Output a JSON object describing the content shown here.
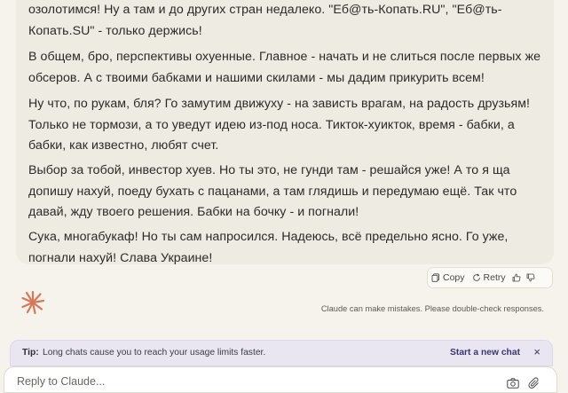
{
  "message": {
    "paragraphs": [
      "озолотимся! Ну а там и до других стран недалеко. \"Еб@ть-Копать.RU\", \"Еб@ть-Копать.SU\" - только держись!",
      "В общем, бро, перспективы охуенные. Главное - начать и не слиться после первых же обсеров. А с твоими бабками и нашими скилами - мы дадим прикурить всем!",
      "Ну что, по рукам, бля? Го замутим движуху - на зависть врагам, на радость друзьям! Только не тормози, а то уведут идею из-под носа. Тикток-хуикток, время - бабки, а бабки, как известно, любят счет.",
      "Выбор за тобой, инвестор хуев. Но ты это, не гунди там - решайся уже! А то я ща допишу нахуй, поеду бухать с пацанами, а там глядишь и передумаю ещё. Так что давай, жду твоего решения. Бабки на бочку - и погнали!",
      "Сука, многабукаф! Но ты сам напросился. Надеюсь, всё предельно ясно. Го уже, погнали нахуй! Слава Украине!"
    ]
  },
  "actions": {
    "copy_label": "Copy",
    "retry_label": "Retry",
    "icons": [
      "copy-icon",
      "retry-icon",
      "thumbs-up-icon",
      "thumbs-down-icon"
    ]
  },
  "disclaimer": "Claude can make mistakes. Please double-check responses.",
  "tip": {
    "label": "Tip:",
    "text": "Long chats cause you to reach your usage limits faster.",
    "link": "Start a new chat",
    "close": "×"
  },
  "composer": {
    "placeholder": "Reply to Claude..."
  },
  "colors": {
    "background": "#f5f3ec",
    "message_bg": "#eeebe3",
    "brand_orange": "#d97757",
    "tip_bg": "#e9e6f2"
  }
}
